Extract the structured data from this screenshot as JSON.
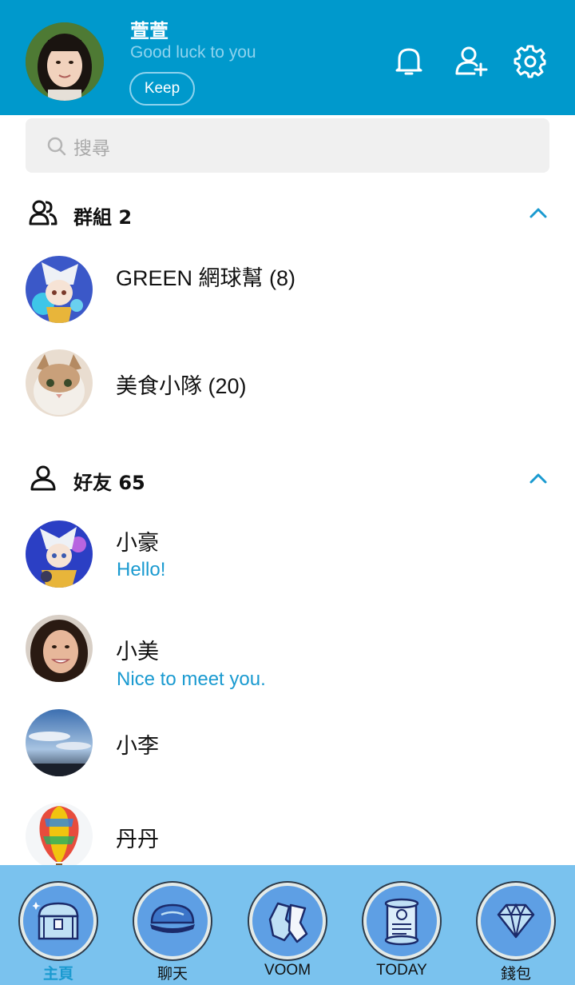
{
  "profile": {
    "name": "萱萱",
    "status": "Good luck to you",
    "keep_label": "Keep"
  },
  "header_icons": [
    "bell-icon",
    "add-friend-icon",
    "gear-icon"
  ],
  "search": {
    "placeholder": "搜尋"
  },
  "groups": {
    "title": "群組 2",
    "items": [
      {
        "name": "GREEN 網球幫 (8)"
      },
      {
        "name": "美食小隊 (20)"
      }
    ]
  },
  "friends": {
    "title": "好友 65",
    "items": [
      {
        "name": "小豪",
        "message": "Hello!"
      },
      {
        "name": "小美",
        "message": "Nice to meet you."
      },
      {
        "name": "小李"
      },
      {
        "name": "丹丹"
      }
    ]
  },
  "tabs": [
    {
      "label": "主頁",
      "icon": "treasure-chest-icon",
      "active": true
    },
    {
      "label": "聊天",
      "icon": "shell-icon"
    },
    {
      "label": "VOOM",
      "icon": "gloves-icon"
    },
    {
      "label": "TODAY",
      "icon": "scroll-icon"
    },
    {
      "label": "錢包",
      "icon": "diamond-icon"
    }
  ],
  "colors": {
    "header_bg": "#0099cc",
    "accent": "#1a9ad0",
    "tabbar_bg": "#7ac2ee"
  }
}
